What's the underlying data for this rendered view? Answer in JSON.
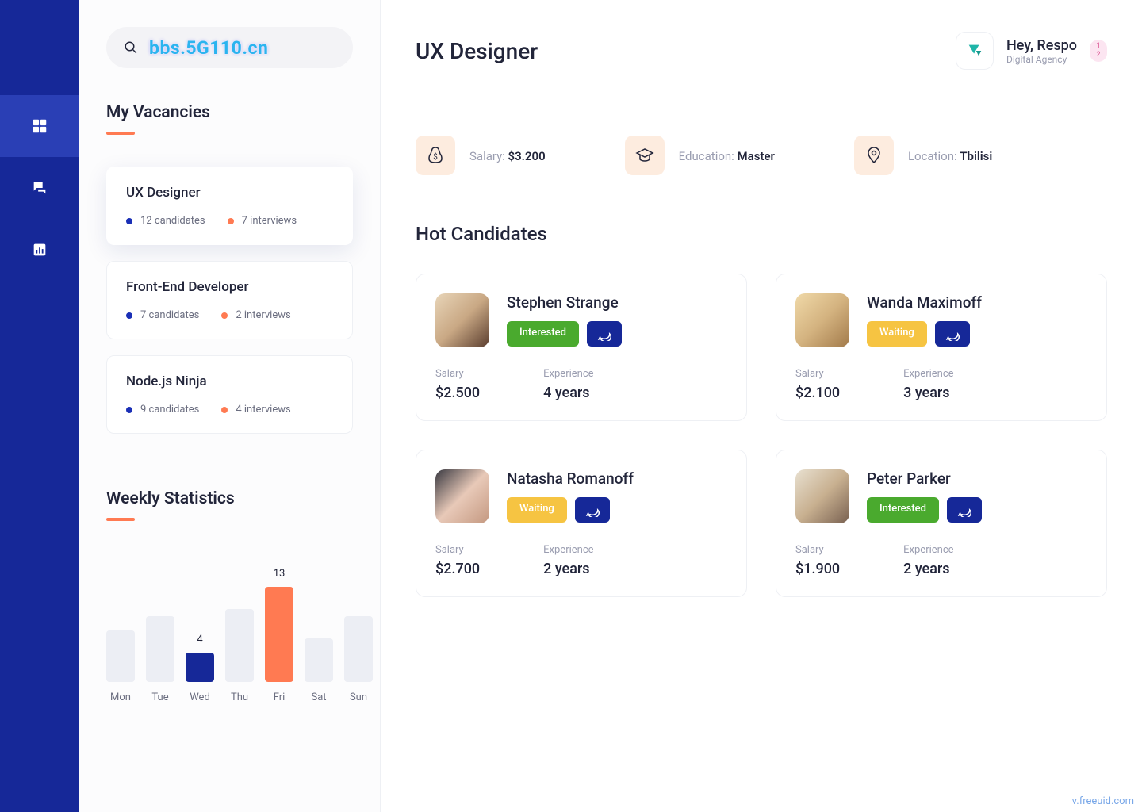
{
  "search": {
    "watermark": "bbs.5G110.cn"
  },
  "sidebar": {
    "vacancies_title": "My Vacancies",
    "stats_title": "Weekly Statistics",
    "vacancies": [
      {
        "title": "UX Designer",
        "candidates": "12 candidates",
        "interviews": "7 interviews"
      },
      {
        "title": "Front-End Developer",
        "candidates": "7 candidates",
        "interviews": "2 interviews"
      },
      {
        "title": "Node.js Ninja",
        "candidates": "9 candidates",
        "interviews": "4 interviews"
      }
    ]
  },
  "chart_data": {
    "type": "bar",
    "categories": [
      "Mon",
      "Tue",
      "Wed",
      "Thu",
      "Fri",
      "Sat",
      "Sun"
    ],
    "values": [
      7,
      9,
      4,
      10,
      13,
      6,
      9
    ],
    "highlights": {
      "2": {
        "color": "#162898",
        "label": "4"
      },
      "4": {
        "color": "#ff7a52",
        "label": "13"
      }
    },
    "title": "Weekly Statistics",
    "ylim": [
      0,
      13
    ]
  },
  "header": {
    "page_title": "UX Designer",
    "greeting": "Hey, Respo",
    "role": "Digital Agency",
    "notif": [
      "1",
      "2"
    ]
  },
  "info": {
    "salary_label": "Salary: ",
    "salary_value": "$3.200",
    "education_label": "Education: ",
    "education_value": "Master",
    "location_label": "Location: ",
    "location_value": "Tbilisi"
  },
  "candidates": {
    "title": "Hot Candidates",
    "labels": {
      "salary": "Salary",
      "experience": "Experience"
    },
    "status": {
      "interested": "Interested",
      "waiting": "Waiting"
    },
    "items": [
      {
        "name": "Stephen Strange",
        "status": "interested",
        "salary": "$2.500",
        "experience": "4 years",
        "avatar": "av1"
      },
      {
        "name": "Wanda Maximoff",
        "status": "waiting",
        "salary": "$2.100",
        "experience": "3 years",
        "avatar": "av2"
      },
      {
        "name": "Natasha Romanoff",
        "status": "waiting",
        "salary": "$2.700",
        "experience": "2 years",
        "avatar": "av3"
      },
      {
        "name": "Peter Parker",
        "status": "interested",
        "salary": "$1.900",
        "experience": "2 years",
        "avatar": "av4"
      }
    ]
  },
  "footer": {
    "mark": "v.freeuid.com"
  }
}
